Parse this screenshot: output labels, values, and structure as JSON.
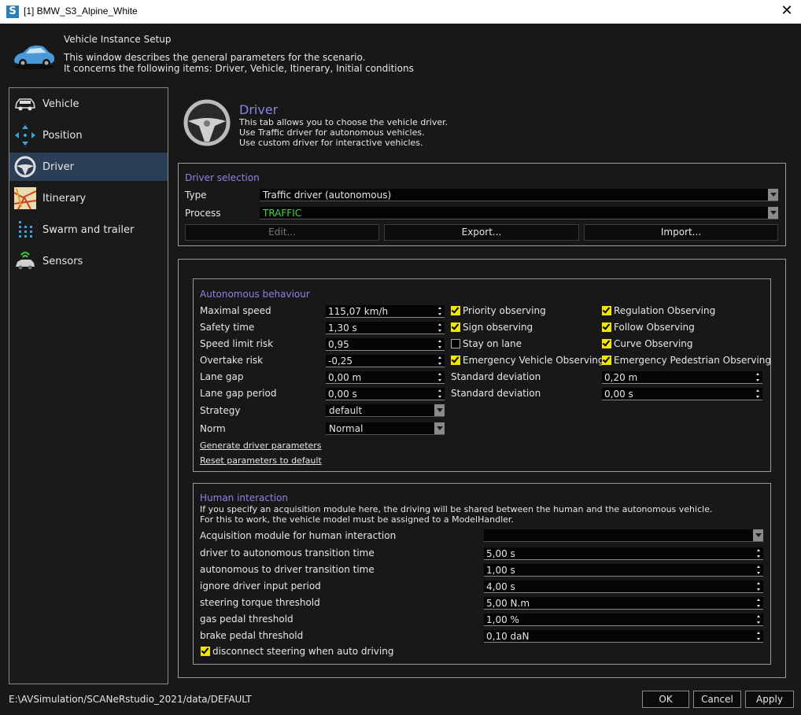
{
  "window": {
    "title": "[1] BMW_S3_Alpine_White",
    "app_icon": "S"
  },
  "header": {
    "title": "Vehicle Instance Setup",
    "line1": "This window describes the general parameters for the scenario.",
    "line2": "It concerns the following items: Driver, Vehicle, Itinerary, Initial conditions"
  },
  "sidebar": {
    "items": [
      {
        "label": "Vehicle",
        "icon": "vehicle-icon"
      },
      {
        "label": "Position",
        "icon": "position-icon"
      },
      {
        "label": "Driver",
        "icon": "steering-wheel-icon"
      },
      {
        "label": "Itinerary",
        "icon": "map-icon"
      },
      {
        "label": "Swarm and trailer",
        "icon": "swarm-icon"
      },
      {
        "label": "Sensors",
        "icon": "sensors-icon"
      }
    ],
    "active": "Driver"
  },
  "driver": {
    "title": "Driver",
    "desc1": "This tab allows you to choose the vehicle driver.",
    "desc2": "Use Traffic driver for autonomous vehicles.",
    "desc3": "Use custom driver for interactive vehicles."
  },
  "selection": {
    "title": "Driver selection",
    "type_label": "Type",
    "type_value": "Traffic driver (autonomous)",
    "process_label": "Process",
    "process_value": "TRAFFIC",
    "edit": "Edit...",
    "export": "Export...",
    "import": "Import..."
  },
  "autonomous": {
    "title": "Autonomous behaviour",
    "max_speed_label": "Maximal speed",
    "max_speed": "115,07 km/h",
    "safety_label": "Safety time",
    "safety": "1,30 s",
    "speed_risk_label": "Speed limit risk",
    "speed_risk": "0,95",
    "overtake_label": "Overtake risk",
    "overtake": "-0,25",
    "lane_gap_label": "Lane gap",
    "lane_gap": "0,00 m",
    "lane_gap_period_label": "Lane gap period",
    "lane_gap_period": "0,00 s",
    "strategy_label": "Strategy",
    "strategy": "default",
    "norm_label": "Norm",
    "norm": "Normal",
    "std1_label": "Standard deviation",
    "std1": "0,20 m",
    "std2_label": "Standard deviation",
    "std2": "0,00 s",
    "checks": {
      "priority": "Priority observing",
      "sign": "Sign observing",
      "stay_lane": "Stay on lane",
      "emergency_vehicle": "Emergency Vehicle Observing",
      "regulation": "Regulation Observing",
      "follow": "Follow Observing",
      "curve": "Curve Observing",
      "emergency_ped": "Emergency Pedestrian Observing"
    },
    "link_generate": "Generate driver parameters",
    "link_reset": "Reset parameters to default"
  },
  "human": {
    "title": "Human interaction",
    "desc1": "If you specify an acquisition module here, the driving will be shared between the human and the autonomous vehicle.",
    "desc2": "For this to work, the vehicle model must be assigned to a ModelHandler.",
    "acq_label": "Acquisition module for human interaction",
    "acq_value": "",
    "rows": [
      {
        "label": "driver to autonomous transition time",
        "value": "5,00 s"
      },
      {
        "label": "autonomous to driver transition time",
        "value": "1,00 s"
      },
      {
        "label": "ignore driver input period",
        "value": "4,00 s"
      },
      {
        "label": "steering torque threshold",
        "value": "5,00 N.m"
      },
      {
        "label": "gas pedal threshold",
        "value": "1,00 %"
      },
      {
        "label": "brake pedal threshold",
        "value": "0,10 daN"
      }
    ],
    "disconnect": "disconnect steering when auto driving"
  },
  "footer": {
    "path": "E:\\AVSimulation/SCANeRstudio_2021/data/DEFAULT",
    "ok": "OK",
    "cancel": "Cancel",
    "apply": "Apply"
  },
  "colors": {
    "accent": "#8a84e6",
    "active": "#2a3f55",
    "check": "#f2e600",
    "process": "#3cdc3c"
  }
}
